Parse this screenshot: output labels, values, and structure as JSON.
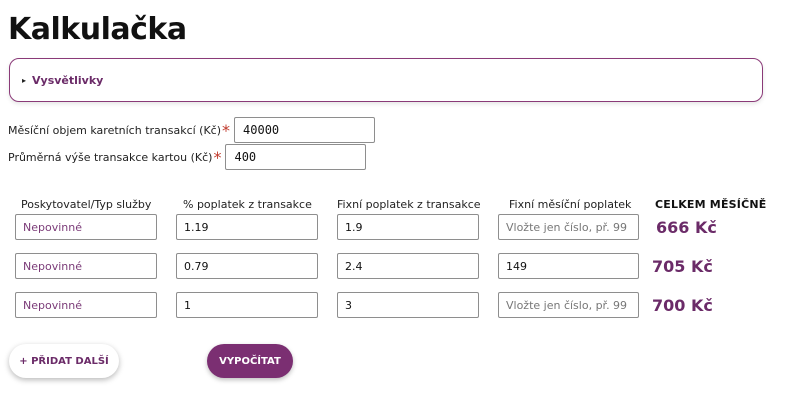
{
  "title": "Kalkulačka",
  "details": {
    "summary": "Vysvětlivky",
    "triangle_icon": "▸"
  },
  "monthly_volume": {
    "label": "Měsíční objem karetních transakcí (Kč)",
    "required_mark": "*",
    "value": "40000"
  },
  "avg_transaction": {
    "label": "Průměrná výše transakce kartou (Kč)",
    "required_mark": "*",
    "value": "400"
  },
  "table": {
    "headers": {
      "provider": "Poskytovatel/Typ služby",
      "percent_fee": "% poplatek z transakce",
      "fixed_fee": "Fixní poplatek z transakce",
      "monthly_fee": "Fixní měsíční poplatek",
      "total": "CELKEM MĚSÍČNĚ"
    },
    "rows": [
      {
        "provider": "",
        "provider_placeholder": "Nepovinné",
        "percent_fee": "1.19",
        "fixed_fee": "1.9",
        "monthly_fee": "",
        "monthly_fee_placeholder": "Vložte jen číslo, př. 99",
        "total": "666 Kč"
      },
      {
        "provider": "",
        "provider_placeholder": "Nepovinné",
        "percent_fee": "0.79",
        "fixed_fee": "2.4",
        "monthly_fee": "149",
        "monthly_fee_placeholder": "Vložte jen číslo, př. 99",
        "total": "705 Kč"
      },
      {
        "provider": "",
        "provider_placeholder": "Nepovinné",
        "percent_fee": "1",
        "fixed_fee": "3",
        "monthly_fee": "",
        "monthly_fee_placeholder": "Vložte jen číslo, př. 99",
        "total": "700 Kč"
      }
    ]
  },
  "buttons": {
    "add_more": "+ PŘIDAT DALŠÍ",
    "calculate": "VYPOČÍTAT"
  },
  "colors": {
    "accent": "#7b2f72",
    "accent_text": "#6b2b68",
    "required": "#c0392b"
  }
}
